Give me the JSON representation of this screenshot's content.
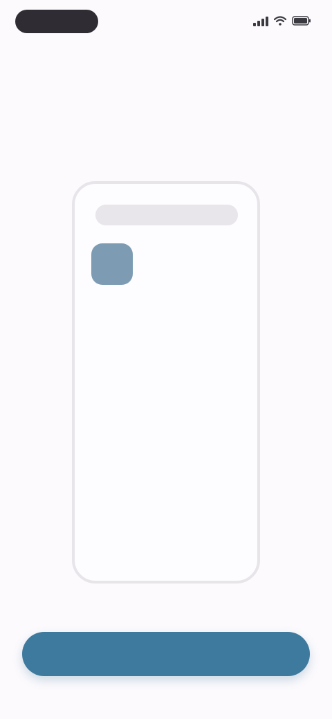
{
  "status_bar": {
    "time": "",
    "icons": [
      "signal-icon",
      "wifi-icon",
      "battery-icon"
    ]
  },
  "title": "",
  "illustration": {
    "search_text": "",
    "app_label": ""
  },
  "primary_button": {
    "label": ""
  },
  "colors": {
    "background": "#fcfafd",
    "accent": "#3e7a9d",
    "app_icon": "#7d9cb3",
    "frame": "#e7e4ea"
  }
}
